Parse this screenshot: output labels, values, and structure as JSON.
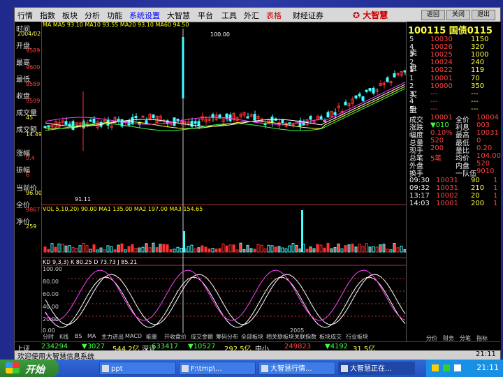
{
  "menubar": {
    "items": [
      "行情",
      "指数",
      "板块",
      "分析",
      "功能",
      "系统设置",
      "大智慧",
      "平台",
      "工具",
      "外汇",
      "表格",
      "财经证券"
    ],
    "brand": "大智慧",
    "win_buttons": [
      "返回",
      "关闭",
      "退出"
    ]
  },
  "left_panel": {
    "labels": [
      "时间",
      "开盘",
      "最高",
      "最低",
      "收盘",
      "成交量",
      "成交额",
      "涨幅",
      "振幅",
      "当前价",
      "全价",
      "净价"
    ],
    "values": [
      "2004/02",
      "9589",
      "9600",
      "9589",
      "9599",
      "45",
      "14.49",
      "0.4",
      "6",
      "96.00",
      "9867",
      "259"
    ]
  },
  "chart": {
    "top_legend": "MA MA5 93.10 MA10 93.55 MA20 93.10 MA60 94.50",
    "peak_label": "100.00",
    "low_label": "91.11",
    "vol_legend": "VOL 5,10,20) 90.00 MA1 135.00 MA2 197.00 MA3 154.65",
    "kd_legend": "KD 9,3,3) K 80.25 D 73.73 J 85.21",
    "kd_axis": [
      "100.00",
      "80.00",
      "60.00",
      "40.00",
      "20.00",
      "0.00"
    ],
    "date_label": "2005",
    "colors": {
      "up": "#ff3030",
      "down": "#40ffff",
      "ma_white": "#ffffff",
      "ma_yellow": "#ffff40",
      "ma_green": "#40ff40",
      "ma_magenta": "#ff40ff"
    }
  },
  "tabs": [
    "分时",
    "K线",
    "BS",
    "MA",
    "主力进出",
    "MACD",
    "能量",
    "开收盘价",
    "成交金额",
    "筹码分布",
    "全部板块",
    "相关联板块",
    "关联指数",
    "板块成交",
    "行业板块"
  ],
  "quote": {
    "title": "100115 国债0115",
    "asks": [
      {
        "lv": "5",
        "price": "10030",
        "vol": "1150"
      },
      {
        "lv": "4",
        "price": "10026",
        "vol": "320"
      },
      {
        "lv": "3",
        "price": "10025",
        "vol": "1000"
      },
      {
        "lv": "2",
        "price": "10024",
        "vol": "240"
      },
      {
        "lv": "1",
        "price": "10022",
        "vol": "119"
      }
    ],
    "bids": [
      {
        "lv": "1",
        "price": "10001",
        "vol": "70"
      },
      {
        "lv": "2",
        "price": "10000",
        "vol": "350"
      },
      {
        "lv": "3",
        "price": "---",
        "vol": "---"
      },
      {
        "lv": "4",
        "price": "---",
        "vol": "---"
      },
      {
        "lv": "5",
        "price": "---",
        "vol": "---"
      }
    ],
    "side_labels": [
      "卖",
      "盘",
      "买",
      "盘"
    ],
    "stats": [
      [
        "成交",
        "10001",
        "全价",
        "10004"
      ],
      [
        "涨跌",
        "▼010",
        "利息",
        "003"
      ],
      [
        "幅度",
        "0.10%",
        "最高",
        "10031"
      ],
      [
        "总量",
        "520",
        "最低",
        "0"
      ],
      [
        "现手",
        "200",
        "量比",
        "0.20"
      ],
      [
        "总笔",
        "5笔",
        "均价",
        "104.00"
      ],
      [
        "外盘",
        "",
        "内盘",
        "520"
      ],
      [
        "换手",
        "",
        "一队伍",
        "9010"
      ]
    ],
    "ticks": [
      [
        "09:30",
        "10031",
        "90",
        "1"
      ],
      [
        "09:32",
        "10031",
        "210",
        "1"
      ],
      [
        "13:17",
        "10002",
        "20",
        "1"
      ],
      [
        "14:03",
        "10001",
        "200",
        "1"
      ]
    ],
    "bottom_tabs": [
      "分价",
      "财务",
      "分笔",
      "指标"
    ]
  },
  "ticker": {
    "items": [
      {
        "text": "上证",
        "cls": "w"
      },
      {
        "text": "234294",
        "cls": "g"
      },
      {
        "text": "▼3027",
        "cls": "g"
      },
      {
        "text": "544.2亿",
        "cls": "y"
      },
      {
        "text": "深证",
        "cls": "w"
      },
      {
        "text": "633417",
        "cls": "g"
      },
      {
        "text": "▼10527",
        "cls": "g"
      },
      {
        "text": "292.5亿",
        "cls": "y"
      },
      {
        "text": "中小",
        "cls": "w"
      },
      {
        "text": "249823",
        "cls": "r"
      },
      {
        "text": "▼4192",
        "cls": "g"
      },
      {
        "text": "31.5亿",
        "cls": "y"
      }
    ]
  },
  "statusbar": {
    "left": "欢迎使用大智慧信息系统",
    "right": "21:11"
  },
  "taskbar": {
    "start": "开始",
    "items": [
      "ppt",
      "F:\\tmp\\...",
      "大智慧行情...",
      "大智慧正在..."
    ],
    "clock": "21:11"
  }
}
